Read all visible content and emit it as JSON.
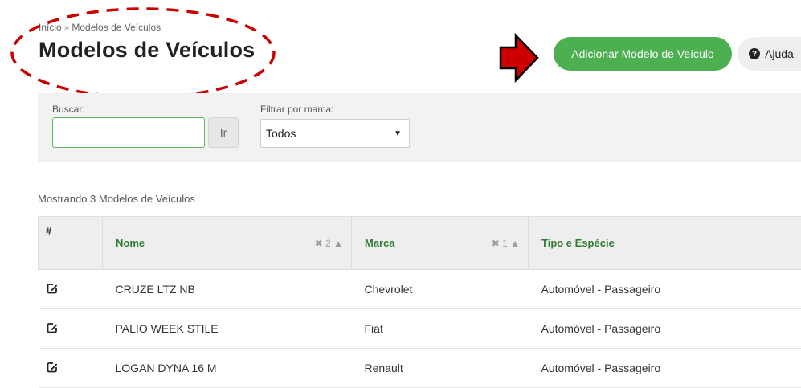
{
  "breadcrumb": {
    "home": "Início",
    "separator": "»",
    "current": "Modelos de Veículos"
  },
  "page_title": "Modelos de Veículos",
  "header": {
    "add_button": "Adicionar Modelo de Veículo",
    "help_button": "Ajuda",
    "help_icon": "?"
  },
  "filters": {
    "search_label": "Buscar:",
    "search_value": "",
    "go_button": "Ir",
    "brand_label": "Filtrar por marca:",
    "brand_selected": "Todos"
  },
  "results": {
    "count_text": "Mostrando 3 Modelos de Veículos"
  },
  "table": {
    "columns": [
      {
        "label": "#"
      },
      {
        "label": "Nome",
        "sort_info": "✖ 2 ▲"
      },
      {
        "label": "Marca",
        "sort_info": "✖ 1 ▲"
      },
      {
        "label": "Tipo e Espécie"
      }
    ],
    "rows": [
      {
        "nome": "CRUZE LTZ NB",
        "marca": "Chevrolet",
        "tipo": "Automóvel - Passageiro"
      },
      {
        "nome": "PALIO WEEK STILE",
        "marca": "Fiat",
        "tipo": "Automóvel - Passageiro"
      },
      {
        "nome": "LOGAN DYNA 16 M",
        "marca": "Renault",
        "tipo": "Automóvel - Passageiro"
      }
    ]
  },
  "colors": {
    "accent_green": "#4caf50",
    "header_link_green": "#2e7d32",
    "annotation_red": "#cc0000"
  },
  "icons": {
    "edit": "edit-icon",
    "help": "question-circle-icon",
    "arrow": "red-arrow-annotation",
    "ellipse": "dashed-ellipse-annotation"
  }
}
